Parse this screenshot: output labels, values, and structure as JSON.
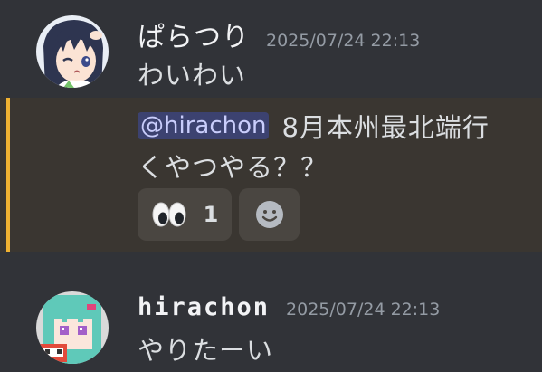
{
  "messages": [
    {
      "username": "ぱらつり",
      "timestamp": "2025/07/24 22:13",
      "text": "わいわい"
    },
    {
      "mention": "@hirachon",
      "text_line1": "8月本州最北端行",
      "text_line2": "くやつやる？？",
      "reactions": [
        {
          "icon": "eyes-emoji-icon",
          "count": "1"
        }
      ],
      "add_reaction_icon": "smiley-add-reaction-icon"
    },
    {
      "username": "hirachon",
      "timestamp": "2025/07/24 22:13",
      "text": "やりたーい"
    }
  ],
  "colors": {
    "background": "#313338",
    "mention_highlight_bg": "#3a3631",
    "mention_bar": "#f0b232",
    "mention_chip_bg": "#3c4270",
    "mention_chip_text": "#c9cdfb",
    "timestamp": "#949ba4"
  }
}
